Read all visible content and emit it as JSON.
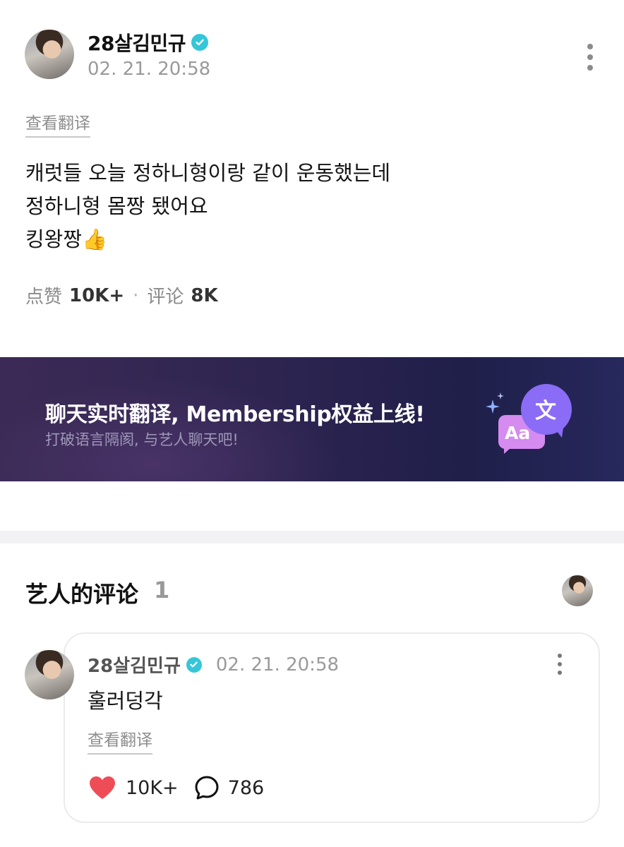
{
  "post": {
    "author": "28살김민규",
    "time": "02. 21. 20:58",
    "translate_label": "查看翻译",
    "lines": [
      "캐럿들 오늘 정하니형이랑 같이 운동했는데",
      "정하니형 몸짱 됐어요",
      "킹왕짱👍"
    ],
    "likes_label": "点赞",
    "likes_count": "10K+",
    "separator": "·",
    "comments_label": "评论",
    "comments_count": "8K"
  },
  "banner": {
    "title": "聊天实时翻译, Membership权益上线!",
    "subtitle": "打破语言隔阂, 与艺人聊天吧!",
    "badge_back": "Aa",
    "badge_front": "文"
  },
  "artist_comments": {
    "title": "艺人的评论",
    "count": "1",
    "comment": {
      "author": "28살김민규",
      "time": "02. 21. 20:58",
      "text": "훌러덩각",
      "translate_label": "查看翻译",
      "likes": "10K+",
      "replies": "786"
    }
  },
  "colors": {
    "verified": "#35c6d8",
    "heart": "#ee4d57",
    "banner_start": "#3b2a55",
    "banner_end": "#27285c"
  },
  "icons": [
    "verified-badge-icon",
    "more-options-icon",
    "heart-icon",
    "speech-bubble-icon",
    "translate-icon"
  ]
}
